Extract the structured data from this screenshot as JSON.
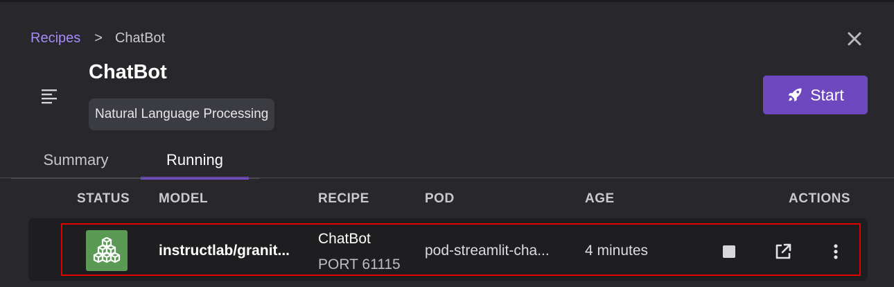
{
  "breadcrumb": {
    "parent": "Recipes",
    "separator": ">",
    "current": "ChatBot"
  },
  "header": {
    "title": "ChatBot",
    "tag": "Natural Language Processing",
    "start_label": "Start"
  },
  "tabs": [
    {
      "label": "Summary",
      "active": false
    },
    {
      "label": "Running",
      "active": true
    }
  ],
  "table": {
    "columns": [
      "STATUS",
      "MODEL",
      "RECIPE",
      "POD",
      "AGE",
      "ACTIONS"
    ],
    "rows": [
      {
        "status": "running",
        "model": "instructlab/granit...",
        "recipe": "ChatBot",
        "port": "PORT 61115",
        "pod": "pod-streamlit-cha...",
        "age": "4 minutes"
      }
    ]
  },
  "icons": {
    "close": "close-icon",
    "menu": "menu-icon",
    "start": "rocket-icon",
    "status": "cubes-icon",
    "stop": "stop-icon",
    "open": "external-link-icon",
    "more": "kebab-icon"
  },
  "colors": {
    "accent": "#6d48bf",
    "link": "#a78bfa",
    "status_running": "#5a9a55",
    "highlight": "#e00000"
  }
}
